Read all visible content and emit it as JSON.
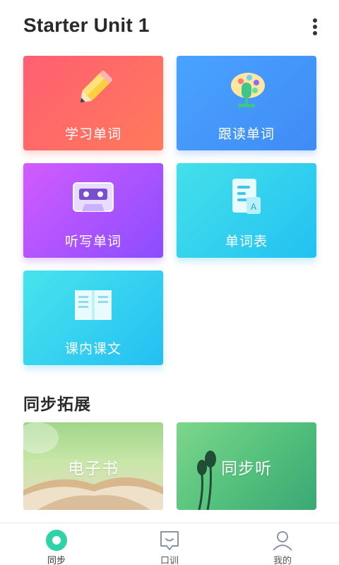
{
  "header": {
    "title": "Starter Unit 1",
    "more_icon": "more-vertical-icon"
  },
  "cards": [
    {
      "label": "学习单词",
      "icon": "pencil-icon",
      "color": "#ff6466"
    },
    {
      "label": "跟读单词",
      "icon": "palette-microphone-icon",
      "color": "#4596fb"
    },
    {
      "label": "听写单词",
      "icon": "cassette-icon",
      "color": "#a553ff"
    },
    {
      "label": "单词表",
      "icon": "document-icon",
      "color": "#33cff0"
    },
    {
      "label": "课内课文",
      "icon": "open-book-icon",
      "color": "#35d0f0"
    }
  ],
  "extension": {
    "title": "同步拓展",
    "items": [
      {
        "label": "电子书",
        "image": "open-book-photo"
      },
      {
        "label": "同步听",
        "image": "earphones-photo"
      }
    ]
  },
  "tabbar": {
    "items": [
      {
        "label": "同步",
        "icon": "circle-dot-icon",
        "active": true
      },
      {
        "label": "口训",
        "icon": "speech-box-icon",
        "active": false
      },
      {
        "label": "我的",
        "icon": "user-icon",
        "active": false
      }
    ],
    "active_color": "#2ed3a8"
  }
}
